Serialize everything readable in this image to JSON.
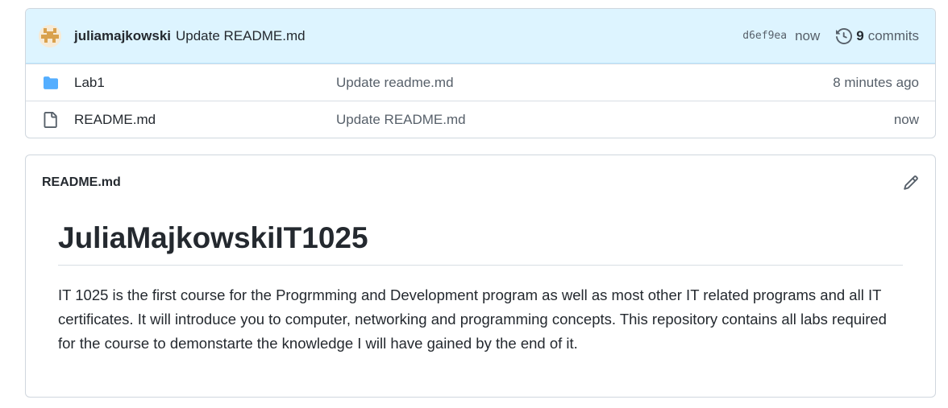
{
  "latest_commit": {
    "author": "juliamajkowski",
    "message": "Update README.md",
    "sha": "d6ef9ea",
    "time": "now",
    "commit_count": "9",
    "commits_label": "commits",
    "avatar_icon": "identicon-avatar",
    "history_icon": "history-icon"
  },
  "files": [
    {
      "name": "Lab1",
      "type": "folder",
      "icon": "folder-icon",
      "message": "Update readme.md",
      "time": "8 minutes ago"
    },
    {
      "name": "README.md",
      "type": "file",
      "icon": "file-icon",
      "message": "Update README.md",
      "time": "now"
    }
  ],
  "readme": {
    "filename": "README.md",
    "edit_icon": "pencil-icon",
    "heading": "JuliaMajkowskiIT1025",
    "body": "IT 1025 is the first course for the Progrmming and Development program as well as most other IT related programs and all IT certificates. It will introduce you to computer, networking and programming concepts. This repository contains all labs required for the course to demonstarte the knowledge I will have gained by the end of it."
  },
  "colors": {
    "commit_bar_bg": "#ddf4ff",
    "folder": "#54aeff",
    "text_muted": "#57606a",
    "border": "#d0d7de"
  }
}
